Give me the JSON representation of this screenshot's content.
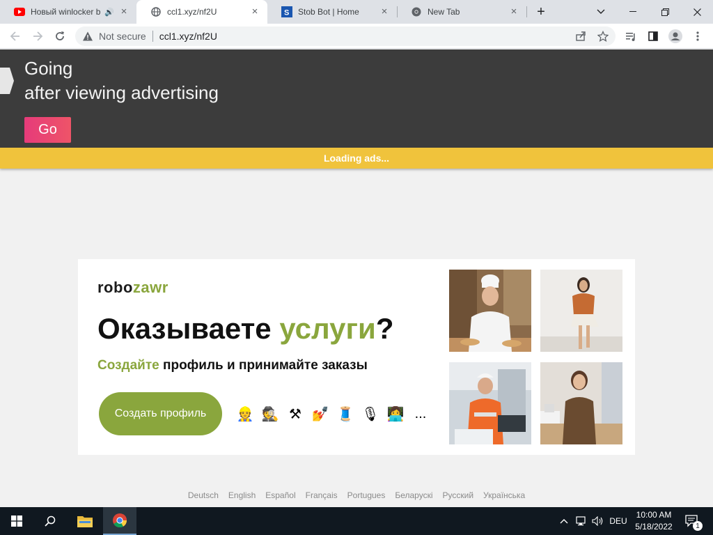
{
  "tabs": [
    {
      "title": "Новый winlocker b",
      "icon": "youtube-icon",
      "audio": true,
      "active": false
    },
    {
      "title": "ccl1.xyz/nf2U",
      "icon": "globe-icon",
      "audio": false,
      "active": true
    },
    {
      "title": "Stob Bot | Home",
      "icon": "stob-icon",
      "audio": false,
      "active": false
    },
    {
      "title": "New Tab",
      "icon": "chrome-icon",
      "audio": false,
      "active": false
    }
  ],
  "omnibox": {
    "security_label": "Not secure",
    "url": "ccl1.xyz/nf2U"
  },
  "hero": {
    "line1": "Going",
    "line2": "after viewing advertising",
    "go_label": "Go"
  },
  "loading_bar": {
    "label": "Loading ads..."
  },
  "ad": {
    "brand_part1": "robo",
    "brand_part2": "zawr",
    "headline_part1": "Оказываете ",
    "headline_highlight": "услуги",
    "headline_end": "?",
    "sub_highlight": "Создайте",
    "sub_rest": " профиль и принимайте заказы",
    "cta_label": "Создать профиль",
    "emojis": [
      "👷",
      "🕵",
      "⚒",
      "💅",
      "🧵",
      "🎙",
      "👩‍💻",
      "..."
    ],
    "photos": [
      "chef-photo",
      "woman-photo",
      "engineer-photo",
      "tailor-photo"
    ]
  },
  "languages": [
    "Deutsch",
    "English",
    "Español",
    "Français",
    "Portugues",
    "Беларускі",
    "Русский",
    "Українська"
  ],
  "taskbar": {
    "input_language": "DEU",
    "time": "10:00 AM",
    "date": "5/18/2022",
    "notification_count": "1"
  },
  "colors": {
    "accent_green": "#8aa63d",
    "go_button": "#e63b7a",
    "loading_bar": "#f0c33c",
    "hero_bg": "#3c3c3c"
  }
}
